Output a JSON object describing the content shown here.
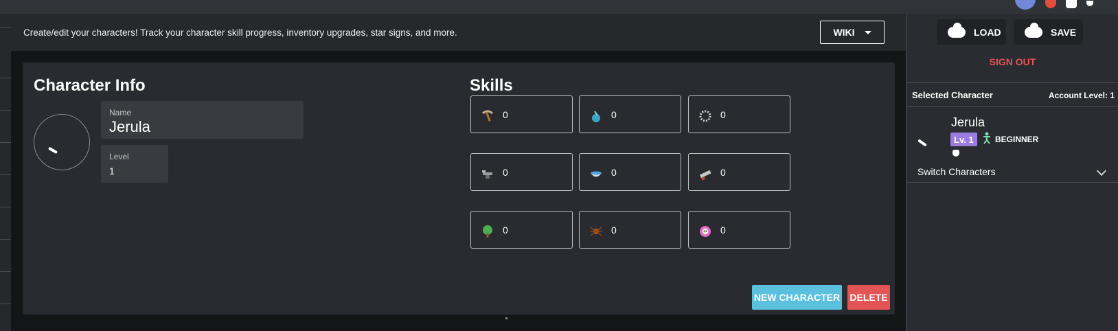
{
  "header": {
    "description": "Create/edit your characters! Track your character skill progress, inventory upgrades, star signs, and more.",
    "wiki_label": "WIKI"
  },
  "character_info": {
    "title": "Character Info",
    "name_label": "Name",
    "name_value": "Jerula",
    "level_label": "Level",
    "level_value": "1"
  },
  "skills": {
    "title": "Skills",
    "items": [
      {
        "icon": "pickaxe-icon",
        "value": "0"
      },
      {
        "icon": "fishing-icon",
        "value": "0"
      },
      {
        "icon": "trapping-icon",
        "value": "0"
      },
      {
        "icon": "anvil-icon",
        "value": "0"
      },
      {
        "icon": "alchemy-bowl-icon",
        "value": "0"
      },
      {
        "icon": "saw-icon",
        "value": "0"
      },
      {
        "icon": "tree-icon",
        "value": "0"
      },
      {
        "icon": "spider-icon",
        "value": "0"
      },
      {
        "icon": "skull-icon",
        "value": "0"
      }
    ]
  },
  "actions": {
    "new_character": "NEW CHARACTER",
    "delete": "DELETE"
  },
  "sidebar": {
    "load": "LOAD",
    "save": "SAVE",
    "sign_out": "SIGN OUT",
    "selected_character": "Selected Character",
    "account_level": "Account Level: 1",
    "char_name": "Jerula",
    "char_level": "Lv. 1",
    "char_class": "BEGINNER",
    "switch": "Switch Characters"
  },
  "colors": {
    "accent_info": "#5bc0de",
    "accent_danger": "#e35454",
    "level_badge": "#9b7de0"
  }
}
